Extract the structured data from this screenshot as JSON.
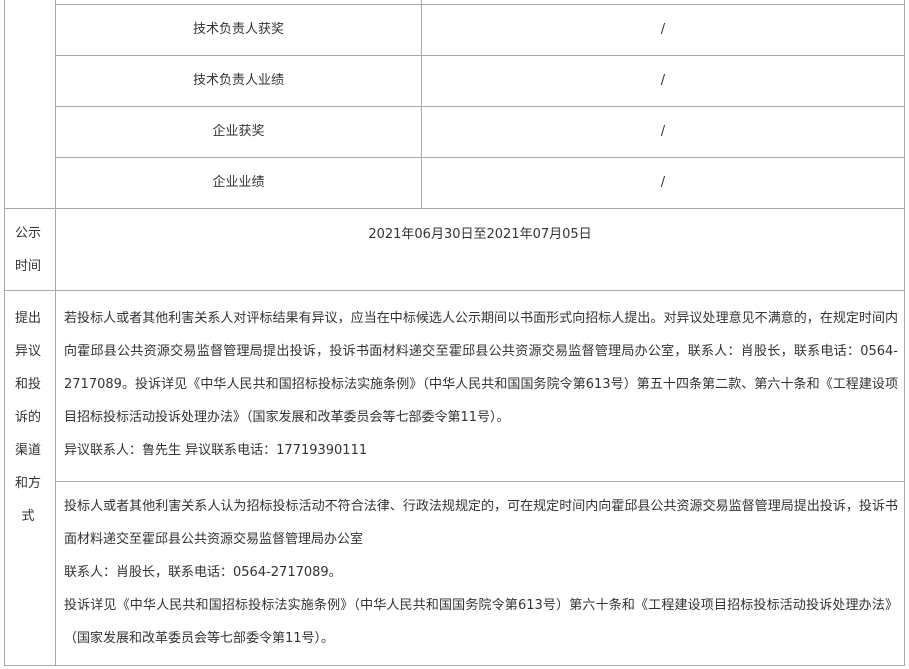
{
  "rows": [
    {
      "label": "技术负责人获奖",
      "value": "/"
    },
    {
      "label": "技术负责人业绩",
      "value": "/"
    },
    {
      "label": "企业获奖",
      "value": "/"
    },
    {
      "label": "企业业绩",
      "value": "/"
    }
  ],
  "publicity": {
    "label_chars": [
      "公示",
      "时间"
    ],
    "period": "2021年06月30日至2021年07月05日"
  },
  "objection": {
    "label_chars": [
      "提出",
      "异议",
      "和投",
      "诉的",
      "渠道",
      "和方",
      "式"
    ],
    "block1": {
      "text": "若投标人或者其他利害关系人对评标结果有异议，应当在中标候选人公示期间以书面形式向招标人提出。对异议处理意见不满意的，在规定时间内向霍邱县公共资源交易监督管理局提出投诉，投诉书面材料递交至霍邱县公共资源交易监督管理局办公室，联系人：肖股长，联系电话：0564-2717089。投诉详见《中华人民共和国招标投标法实施条例》（中华人民共和国国务院令第613号）第五十四条第二款、第六十条和《工程建设项目招标投标活动投诉处理办法》（国家发展和改革委员会等七部委令第11号）。",
      "contact": "异议联系人：鲁先生 异议联系电话：17719390111"
    },
    "block2": {
      "line1": "投标人或者其他利害关系人认为招标投标活动不符合法律、行政法规规定的，可在规定时间内向霍邱县公共资源交易监督管理局提出投诉，投诉书面材料递交至霍邱县公共资源交易监督管理局办公室",
      "line2": "联系人：肖股长，联系电话：0564-2717089。",
      "line3": "投诉详见《中华人民共和国招标投标法实施条例》（中华人民共和国国务院令第613号）第六十条和《工程建设项目招标投标活动投诉处理办法》（国家发展和改革委员会等七部委令第11号）。"
    }
  }
}
